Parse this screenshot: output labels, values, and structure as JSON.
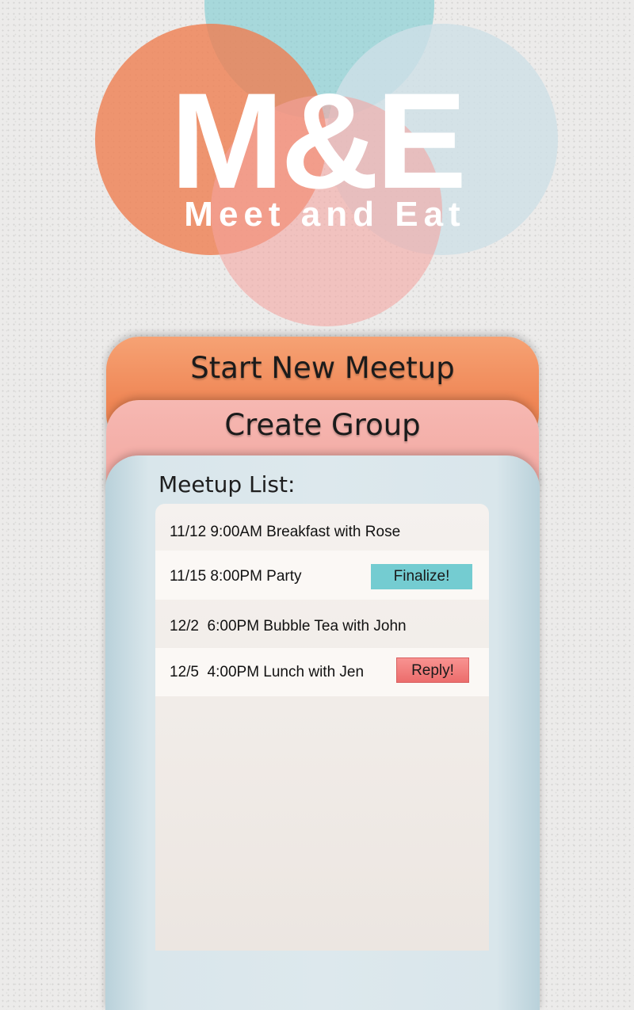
{
  "colors": {
    "orange": "#ee8052",
    "teal": "#70c8cd",
    "light_blue": "#cedfe6",
    "pink": "#f4a4a0",
    "finalize_button": "#74ccd1",
    "reply_button": "#ec6d6c"
  },
  "logo": {
    "main": "M&E",
    "tagline": "Meet and Eat"
  },
  "menu": {
    "start_meetup": "Start New Meetup",
    "create_group": "Create Group"
  },
  "meetup_list": {
    "heading": "Meetup List:",
    "items": [
      {
        "text": "11/12 9:00AM Breakfast with Rose",
        "action": ""
      },
      {
        "text": "11/15 8:00PM Party",
        "action": "Finalize!"
      },
      {
        "text": "12/2  6:00PM Bubble Tea with John",
        "action": ""
      },
      {
        "text": "12/5  4:00PM Lunch with Jen",
        "action": "Reply!"
      }
    ]
  }
}
